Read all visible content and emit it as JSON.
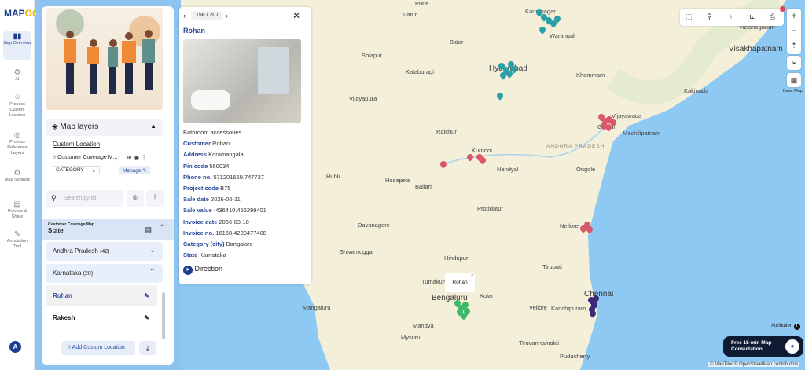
{
  "app": {
    "logo_main": "MAP",
    "logo_accent": "OG"
  },
  "rail": [
    {
      "label": "Map Overview",
      "icon": "map-icon"
    },
    {
      "label": "AI",
      "icon": "ai-icon"
    },
    {
      "label": "Process Custom Location",
      "icon": "location-pin-icon"
    },
    {
      "label": "Process Reference Layers",
      "icon": "layers-icon"
    },
    {
      "label": "Map Settings",
      "icon": "gear-icon"
    },
    {
      "label": "Preview & Share",
      "icon": "share-icon"
    },
    {
      "label": "Annotation Tool",
      "icon": "annotation-icon"
    }
  ],
  "user": {
    "initial": "A"
  },
  "panel": {
    "map_layers": "Map layers",
    "custom_location": "Custom Location",
    "layer_name": "Customer Coverage M...",
    "category": "CATEGORY",
    "manage": "Manage",
    "search_placeholder": "Search by titl",
    "group_sub": "Customer Coverage Map",
    "group_title": "State",
    "states": [
      {
        "name": "Andhra Pradesh",
        "count": "(42)"
      },
      {
        "name": "Karnataka",
        "count": "(20)"
      }
    ],
    "items": [
      "Rohan",
      "Rakesh"
    ],
    "add_button": "Add Custom Location"
  },
  "popup": {
    "pager": "158 / 207",
    "title": "Rohan",
    "description": "Bathroom accessories",
    "fields": [
      {
        "k": "Customer",
        "v": "Rohan"
      },
      {
        "k": "Address",
        "v": "Koramangala"
      },
      {
        "k": "Pin code",
        "v": "560034"
      },
      {
        "k": "Phone no.",
        "v": "571201669.747737"
      },
      {
        "k": "Project code",
        "v": "B75"
      },
      {
        "k": "Sale date",
        "v": "2026-06-11"
      },
      {
        "k": "Sale value",
        "v": "-436410.456299401"
      },
      {
        "k": "Invoice date",
        "v": "2066-03-18"
      },
      {
        "k": "Invoice no.",
        "v": "16168.4280477408"
      },
      {
        "k": "Category (city)",
        "v": "Bangalore"
      },
      {
        "k": "State",
        "v": "Karnataka"
      }
    ],
    "direction": "Direction"
  },
  "map": {
    "tooltip": "Rohan",
    "base_map": "Base Map",
    "attribution": "Attribution",
    "credits": "© MapTiler © OpenStreetMap contributors",
    "consult": "Free 15-min Map Consultation",
    "colors": {
      "telangana": "#2aa1a8",
      "andhra": "#d9586a",
      "karnataka": "#3cb96a",
      "tamilnadu": "#3b2a75"
    },
    "cities": [
      {
        "n": "Pune"
      },
      {
        "n": "Latur"
      },
      {
        "n": "Bidar"
      },
      {
        "n": "Solapur"
      },
      {
        "n": "Kalaburagi"
      },
      {
        "n": "Vijayapura"
      },
      {
        "n": "Hyderabad"
      },
      {
        "n": "Karimnagar"
      },
      {
        "n": "Warangal"
      },
      {
        "n": "Khammam"
      },
      {
        "n": "Visakhapatnam"
      },
      {
        "n": "Vizianagaram"
      },
      {
        "n": "Kakinada"
      },
      {
        "n": "Vijayawada"
      },
      {
        "n": "Guntur"
      },
      {
        "n": "Machilipatnam"
      },
      {
        "n": "Ongole"
      },
      {
        "n": "Raichur"
      },
      {
        "n": "Kurnool"
      },
      {
        "n": "Nandyal"
      },
      {
        "n": "Hubli"
      },
      {
        "n": "Hosapete"
      },
      {
        "n": "Ballari"
      },
      {
        "n": "Proddatur"
      },
      {
        "n": "Davanagere"
      },
      {
        "n": "Shivamogga"
      },
      {
        "n": "Hindupur"
      },
      {
        "n": "Nellore"
      },
      {
        "n": "Tirupati"
      },
      {
        "n": "Tumakuru"
      },
      {
        "n": "Kolar"
      },
      {
        "n": "Bengaluru"
      },
      {
        "n": "Chennai"
      },
      {
        "n": "Vellore"
      },
      {
        "n": "Kanchipuram"
      },
      {
        "n": "Mangaluru"
      },
      {
        "n": "Mandya"
      },
      {
        "n": "Mysuru"
      },
      {
        "n": "Tiruvannamalai"
      },
      {
        "n": "Puducherry"
      },
      {
        "n": "ANDHRA PRADESH"
      }
    ]
  }
}
